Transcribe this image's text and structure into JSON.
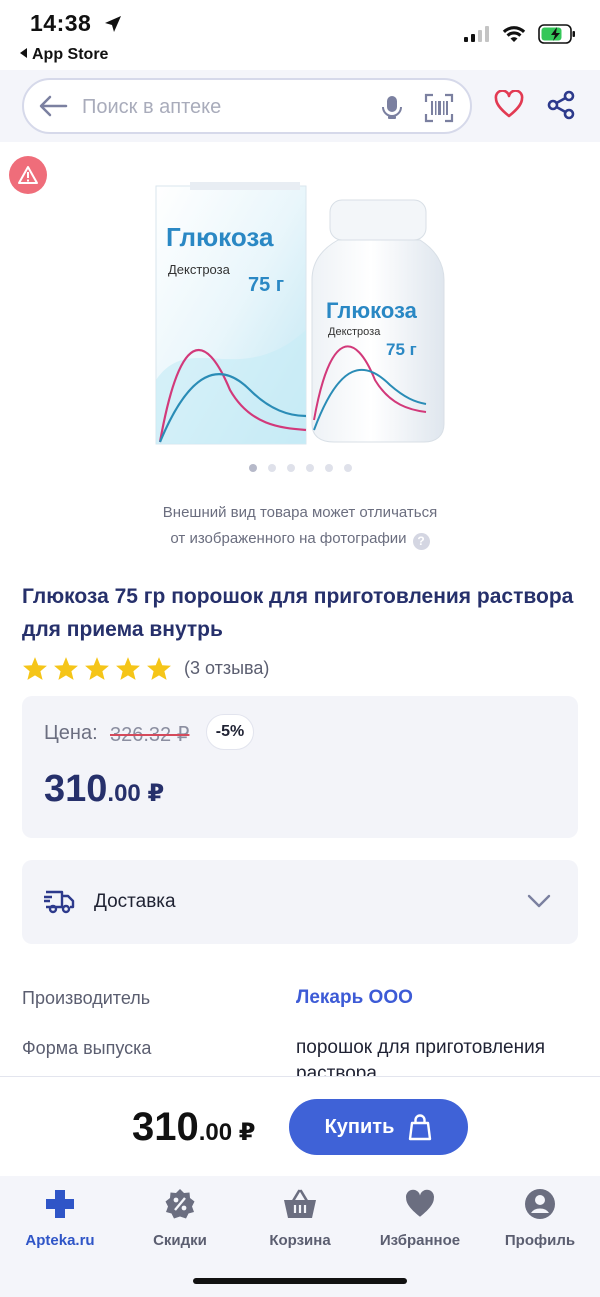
{
  "status_bar": {
    "time": "14:38",
    "back_app": "App Store"
  },
  "search": {
    "placeholder": "Поиск в аптеке"
  },
  "icons": [
    "back-arrow-icon",
    "mic-icon",
    "barcode-icon",
    "heart-icon",
    "share-icon",
    "warning-icon",
    "star-icon",
    "truck-icon",
    "chevron-down-icon",
    "bag-icon",
    "cross-icon",
    "discount-icon",
    "basket-icon",
    "profile-icon"
  ],
  "colors": {
    "brand": "#3f62d7",
    "title": "#26306b",
    "warning": "#ef6d7a",
    "star": "#f5c518",
    "heart": "#e23a52"
  },
  "gallery": {
    "slides": 6,
    "active_slide": 1
  },
  "disclaimer": {
    "line1": "Внешний вид товара может отличаться",
    "line2": "от изображенного на фотографии"
  },
  "product": {
    "title": "Глюкоза 75 гр порошок для приготовления раствора для приема внутрь",
    "rating": 5,
    "reviews": "(3 отзыва)",
    "package_name": "Глюкоза",
    "package_sub": "Декстроза",
    "package_weight": "75 г"
  },
  "price": {
    "label": "Цена:",
    "old": "326.32 ₽",
    "discount": "-5%",
    "integer": "310",
    "decimals": ".00 ₽"
  },
  "delivery": {
    "label": "Доставка"
  },
  "specs": [
    {
      "label": "Производитель",
      "value": "Лекарь ООО"
    },
    {
      "label": "Форма выпуска",
      "value": "порошок для приготовления раствора"
    }
  ],
  "buy_bar": {
    "integer": "310",
    "decimals": ".00 ₽",
    "button": "Купить"
  },
  "tabs": [
    {
      "label": "Apteka.ru",
      "icon": "cross-icon",
      "active": true
    },
    {
      "label": "Скидки",
      "icon": "discount-icon",
      "active": false
    },
    {
      "label": "Корзина",
      "icon": "basket-icon",
      "active": false
    },
    {
      "label": "Избранное",
      "icon": "heart-icon",
      "active": false
    },
    {
      "label": "Профиль",
      "icon": "profile-icon",
      "active": false
    }
  ]
}
